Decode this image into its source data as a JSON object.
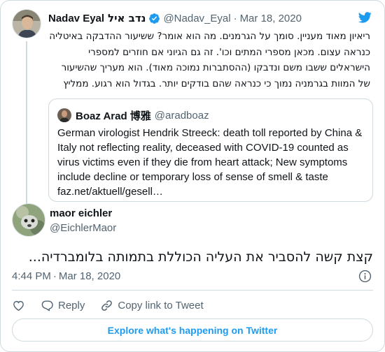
{
  "parent_tweet": {
    "author_name": "Nadav Eyal",
    "author_name_hebrew": "נדב איל",
    "handle": "@Nadav_Eyal",
    "separator": "·",
    "date": "Mar 18, 2020",
    "text": "ריאיון מאוד מעניין. סומך על הגרמנים. מה הוא אומר? ששיעור ההדבקה באיטליה כנראה עצום. מכאן מספרי המתים וכו'. זה גם הגיוני אם חוזרים למספרי הישראלים ששבו משם ונדבקו (ההסתברות נמוכה מאוד). הוא מעריך שהשיעור של המוות בגרמניה נמוך כי כנראה שהם בודקים יותר. בגדול הוא רגוע. ממליץ"
  },
  "quoted_tweet": {
    "author_name": "Boaz Arad 博雅",
    "handle": "@aradboaz",
    "text": "German virologist Hendrik Streeck: death toll reported by China & Italy not reflecting reality, deceased with COVID-19 counted as virus victims even if they die from heart attack; New symptoms include decline or temporary loss of sense of smell & taste faz.net/aktuell/gesell…"
  },
  "reply_tweet": {
    "author_name": "maor eichler",
    "handle": "@EichlerMaor",
    "text": "קצת קשה להסביר את העליה הכוללת בתמותה בלומברדיה...",
    "time": "4:44 PM",
    "separator": "·",
    "date": "Mar 18, 2020"
  },
  "actions": {
    "reply_label": "Reply",
    "copy_link_label": "Copy link to Tweet"
  },
  "explore_button_label": "Explore what's happening on Twitter",
  "colors": {
    "accent": "#1d9bf0",
    "secondary_text": "#536471",
    "border": "#cfd9de"
  },
  "icons": [
    "verified-badge-icon",
    "twitter-bird-icon",
    "info-icon",
    "heart-icon",
    "reply-icon",
    "link-icon"
  ]
}
